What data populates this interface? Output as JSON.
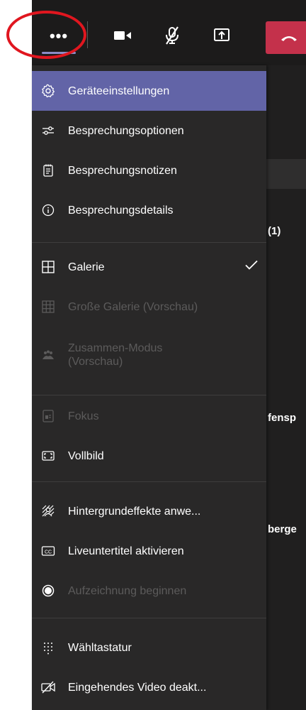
{
  "toolbar": {
    "more_label": "•••",
    "colors": {
      "accent": "#6264a7",
      "hangup": "#c4314b",
      "annotation": "#e0161f"
    },
    "icons": [
      "more-options-icon",
      "camera-icon",
      "mic-off-icon",
      "share-screen-icon",
      "hang-up-icon"
    ]
  },
  "background": {
    "fragments": [
      "(1)",
      "fensp",
      "berge"
    ]
  },
  "menu": {
    "items": [
      {
        "label": "Geräteeinstellungen",
        "icon": "gear-icon",
        "state": "selected"
      },
      {
        "label": "Besprechungsoptionen",
        "icon": "sliders-icon",
        "state": "enabled"
      },
      {
        "label": "Besprechungsnotizen",
        "icon": "notes-icon",
        "state": "enabled"
      },
      {
        "label": "Besprechungsdetails",
        "icon": "info-icon",
        "state": "enabled"
      },
      {
        "label": "Galerie",
        "icon": "grid-icon",
        "state": "checked"
      },
      {
        "label": "Große Galerie (Vorschau)",
        "icon": "large-grid-icon",
        "state": "disabled"
      },
      {
        "label": "Zusammen-Modus",
        "label2": "(Vorschau)",
        "icon": "together-mode-icon",
        "state": "disabled"
      },
      {
        "label": "Fokus",
        "icon": "focus-icon",
        "state": "disabled"
      },
      {
        "label": "Vollbild",
        "icon": "fullscreen-icon",
        "state": "enabled"
      },
      {
        "label": "Hintergrundeffekte anwe...",
        "icon": "background-effects-icon",
        "state": "enabled"
      },
      {
        "label": "Liveuntertitel aktivieren",
        "icon": "captions-icon",
        "state": "enabled"
      },
      {
        "label": "Aufzeichnung beginnen",
        "icon": "record-icon",
        "state": "disabled"
      },
      {
        "label": "Wähltastatur",
        "icon": "dialpad-icon",
        "state": "enabled"
      },
      {
        "label": "Eingehendes Video deakt...",
        "icon": "video-off-icon",
        "state": "enabled"
      }
    ]
  }
}
